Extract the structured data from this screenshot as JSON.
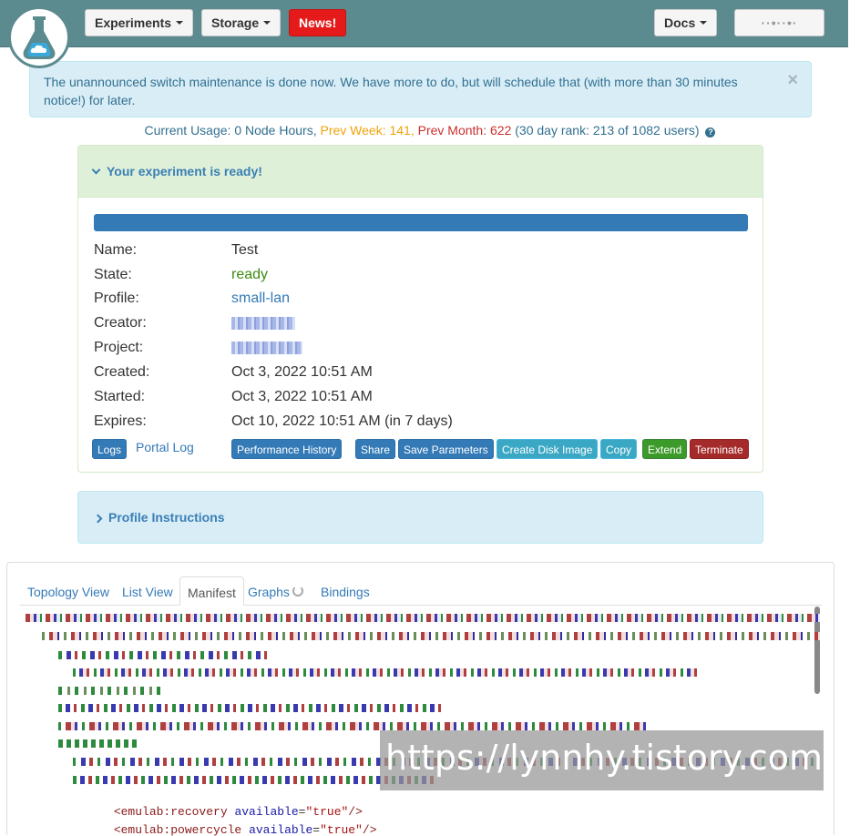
{
  "navbar": {
    "experiments_label": "Experiments",
    "storage_label": "Storage",
    "news_label": "News!",
    "docs_label": "Docs",
    "user_label": "··•··•·"
  },
  "alert": {
    "message": "The unannounced switch maintenance is done now. We have more to do, but will schedule that (with more than 30 minutes notice!) for later.",
    "close": "×"
  },
  "usage": {
    "current": "Current Usage: 0 Node Hours,",
    "prev_week": "Prev Week: 141,",
    "prev_month": "Prev Month: 622",
    "rank": "(30 day rank: 213 of 1082 users)",
    "help": "?"
  },
  "experiment": {
    "heading": "Your experiment is ready!",
    "progress": 1.0,
    "fields": {
      "name_label": "Name:",
      "name": "Test",
      "state_label": "State:",
      "state": "ready",
      "profile_label": "Profile:",
      "profile": "small-lan",
      "creator_label": "Creator:",
      "project_label": "Project:",
      "created_label": "Created:",
      "created": "Oct 3, 2022 10:51 AM",
      "started_label": "Started:",
      "started": "Oct 3, 2022 10:51 AM",
      "expires_label": "Expires:",
      "expires": "Oct 10, 2022 10:51 AM (in 7 days)"
    },
    "buttons": {
      "logs": "Logs",
      "portal_log": "Portal Log",
      "performance_history": "Performance History",
      "share": "Share",
      "save_parameters": "Save Parameters",
      "create_disk_image": "Create Disk Image",
      "copy": "Copy",
      "extend": "Extend",
      "terminate": "Terminate"
    }
  },
  "profile_instructions": {
    "heading": "Profile Instructions"
  },
  "tabs": {
    "topology": "Topology View",
    "list": "List View",
    "manifest": "Manifest",
    "graphs": "Graphs",
    "bindings": "Bindings"
  },
  "manifest": {
    "line1_tag": "<emulab:recovery",
    "line1_attr": "available",
    "line1_val": "\"true\"",
    "line1_end": "/>",
    "line2_tag": "<emulab:powercycle",
    "line2_attr": "available",
    "line2_val": "\"true\"",
    "line2_end": "/>"
  },
  "watermark": "https://lynnhy.tistory.com"
}
